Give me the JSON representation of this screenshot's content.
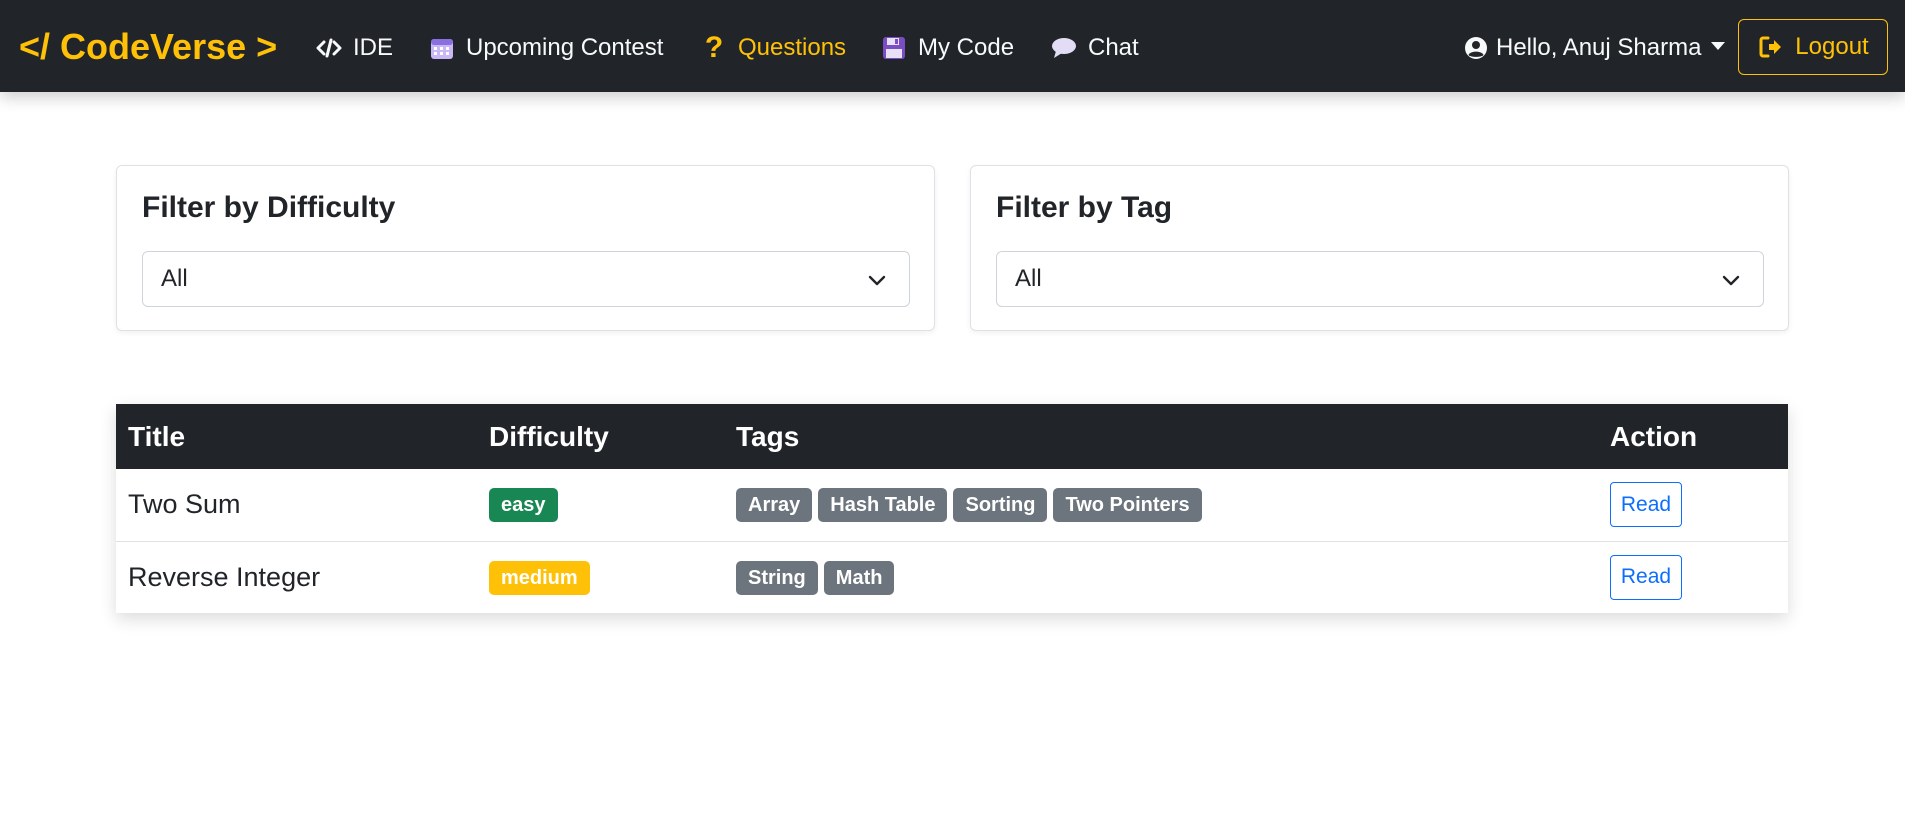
{
  "navbar": {
    "brand": "</ CodeVerse >",
    "links": [
      {
        "label": "IDE",
        "icon": "code-icon",
        "active": false
      },
      {
        "label": "Upcoming Contest",
        "icon": "calendar-icon",
        "active": false
      },
      {
        "label": "Questions",
        "icon": "question-icon",
        "active": true
      },
      {
        "label": "My Code",
        "icon": "floppy-disk-icon",
        "active": false
      },
      {
        "label": "Chat",
        "icon": "chat-bubble-icon",
        "active": false
      }
    ],
    "user_greeting": "Hello, Anuj Sharma",
    "logout_label": "Logout",
    "accent_color": "#ffc107"
  },
  "filters": {
    "difficulty": {
      "title": "Filter by Difficulty",
      "selected": "All"
    },
    "tag": {
      "title": "Filter by Tag",
      "selected": "All"
    }
  },
  "table": {
    "headers": {
      "title": "Title",
      "difficulty": "Difficulty",
      "tags": "Tags",
      "action": "Action"
    },
    "rows": [
      {
        "title": "Two Sum",
        "difficulty": "easy",
        "tags": [
          "Array",
          "Hash Table",
          "Sorting",
          "Two Pointers"
        ],
        "action": "Read"
      },
      {
        "title": "Reverse Integer",
        "difficulty": "medium",
        "tags": [
          "String",
          "Math"
        ],
        "action": "Read"
      }
    ]
  }
}
